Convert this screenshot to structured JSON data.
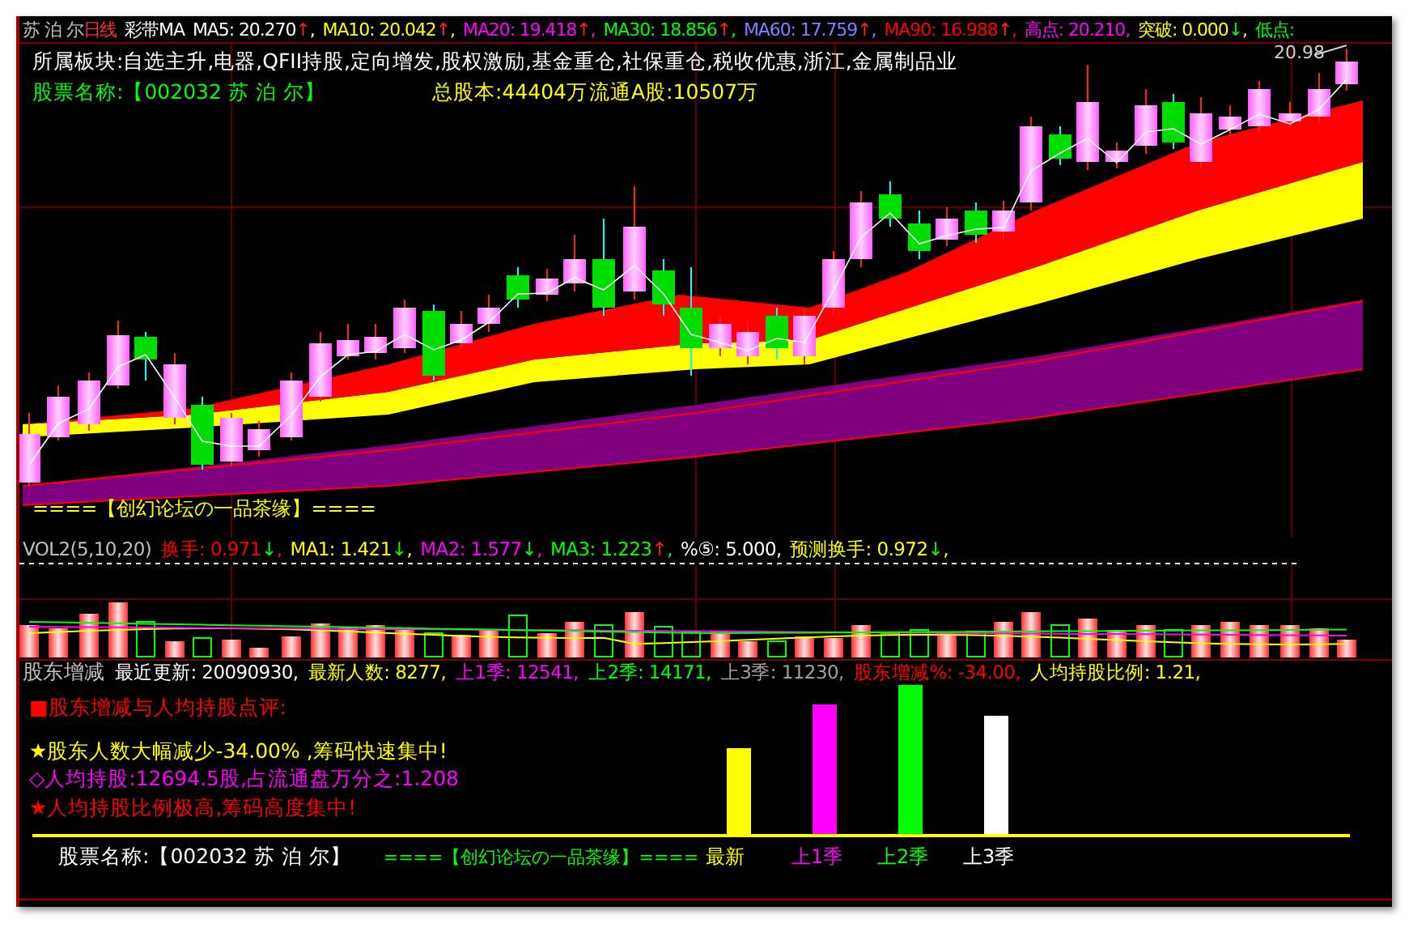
{
  "header": {
    "stock": "苏 泊 尔",
    "period": "日线",
    "indicator": "彩带MA",
    "items": [
      {
        "text": "MA5: 20.270",
        "arrow": "↑",
        "rising": true,
        "sep": ",",
        "color": "#ffffff"
      },
      {
        "text": "MA10: 20.042",
        "arrow": "↑",
        "rising": true,
        "sep": ",",
        "color": "#ffff00"
      },
      {
        "text": "MA20: 19.418",
        "arrow": "↑",
        "rising": true,
        "sep": ",",
        "color": "#ff00ff"
      },
      {
        "text": "MA30: 18.856",
        "arrow": "↑",
        "rising": true,
        "sep": ",",
        "color": "#00ff00"
      },
      {
        "text": "MA60: 17.759",
        "arrow": "↑",
        "rising": true,
        "sep": ",",
        "color": "#8080ff"
      },
      {
        "text": "MA90: 16.988",
        "arrow": "↑",
        "rising": true,
        "sep": ",",
        "color": "#ff0000"
      },
      {
        "text": "高点: 20.210,",
        "color": "#ff00ff"
      },
      {
        "text": "突破: 0.000",
        "arrow": "↓",
        "rising": false,
        "sep": ",",
        "color": "#ffff00"
      },
      {
        "text": "低点:",
        "color": "#00ff00"
      }
    ]
  },
  "main_chart": {
    "sectors": "所属板块:自选主升,电器,QFII持股,定向增发,股权激励,基金重仓,社保重仓,税收优惠,浙江,金属制品业",
    "stock_name": "股票名称:【002032 苏 泊 尔】",
    "total_shares": "总股本:44404万",
    "float_shares": "流通A股:10507万",
    "high_label": "20.98",
    "footer": "====【创幻论坛の一品茶缘】===="
  },
  "volume": {
    "title": "VOL2(5,10,20)",
    "items": [
      {
        "text": "换手: 0.971",
        "arrow": "↓",
        "rising": false,
        "sep": ",",
        "color": "#ff0000"
      },
      {
        "text": "MA1: 1.421",
        "arrow": "↓",
        "rising": false,
        "sep": ",",
        "color": "#ffff00"
      },
      {
        "text": "MA2: 1.577",
        "arrow": "↓",
        "rising": false,
        "sep": ",",
        "color": "#ff00ff"
      },
      {
        "text": "MA3: 1.223",
        "arrow": "↑",
        "rising": true,
        "sep": ",",
        "color": "#00ff00"
      },
      {
        "text": "%⑤: 5.000,",
        "color": "#ffffff"
      },
      {
        "text": "预测换手: 0.972",
        "arrow": "↓",
        "rising": false,
        "sep": ",",
        "color": "#ffff00"
      }
    ]
  },
  "shareholders": {
    "title": "股东增减",
    "items": [
      {
        "text": "最近更新: 20090930,",
        "color": "#ffffff"
      },
      {
        "text": "最新人数: 8277,",
        "color": "#ffff00"
      },
      {
        "text": "上1季: 12541,",
        "color": "#ff00ff"
      },
      {
        "text": "上2季: 14171,",
        "color": "#00ff00"
      },
      {
        "text": "上3季: 11230,",
        "color": "#a0a0a0"
      },
      {
        "text": "股东增减%: -34.00,",
        "color": "#ff0000"
      },
      {
        "text": "人均持股比例: 1.21,",
        "color": "#ffff00"
      }
    ]
  },
  "comments": [
    {
      "text": "■股东增减与人均持股点评:",
      "color": "#ff0000"
    },
    {
      "text": "★股东人数大幅减少-34.00% ,筹码快速集中!",
      "color": "#ffff00"
    },
    {
      "text": "◇人均持股:12694.5股,占流通盘万分之:1.208",
      "color": "#ff00ff"
    },
    {
      "text": "★人均持股比例极高,筹码高度集中!",
      "color": "#ff0000"
    }
  ],
  "bar_chart": {
    "bars": [
      {
        "label": "最新",
        "color": "#ffff00"
      },
      {
        "label": "上1季",
        "color": "#ff00ff"
      },
      {
        "label": "上2季",
        "color": "#00ff00"
      },
      {
        "label": "上3季",
        "color": "#ffffff"
      }
    ]
  },
  "footer": {
    "stock_name": "股票名称:【002032 苏 泊 尔】",
    "forum": "====【创幻论坛の一品茶缘】===="
  }
}
